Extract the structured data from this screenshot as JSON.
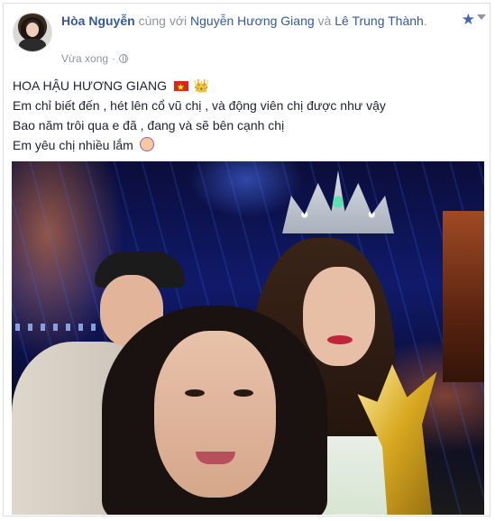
{
  "post": {
    "author": "Hòa Nguyễn",
    "with_text": " cùng với ",
    "tag1": "Nguyễn Hương Giang",
    "and_text": " và ",
    "tag2": "Lê Trung Thành",
    "period": ".",
    "timestamp": "Vừa xong",
    "privacy_separator": "·",
    "lines": [
      "HOA HẬU HƯƠNG GIANG",
      "Em chỉ biết đến , hét lên cổ vũ chị , và động viên chị được như vậy",
      "Bao năm trôi qua e đã , đang và sẽ bên cạnh chị",
      "Em yêu chị nhiều lắm"
    ]
  },
  "icons": {
    "star": "★",
    "crown": "👑",
    "globe": "globe-icon"
  },
  "colors": {
    "link": "#365899",
    "meta": "#90949c",
    "accent": "#4267b2"
  }
}
